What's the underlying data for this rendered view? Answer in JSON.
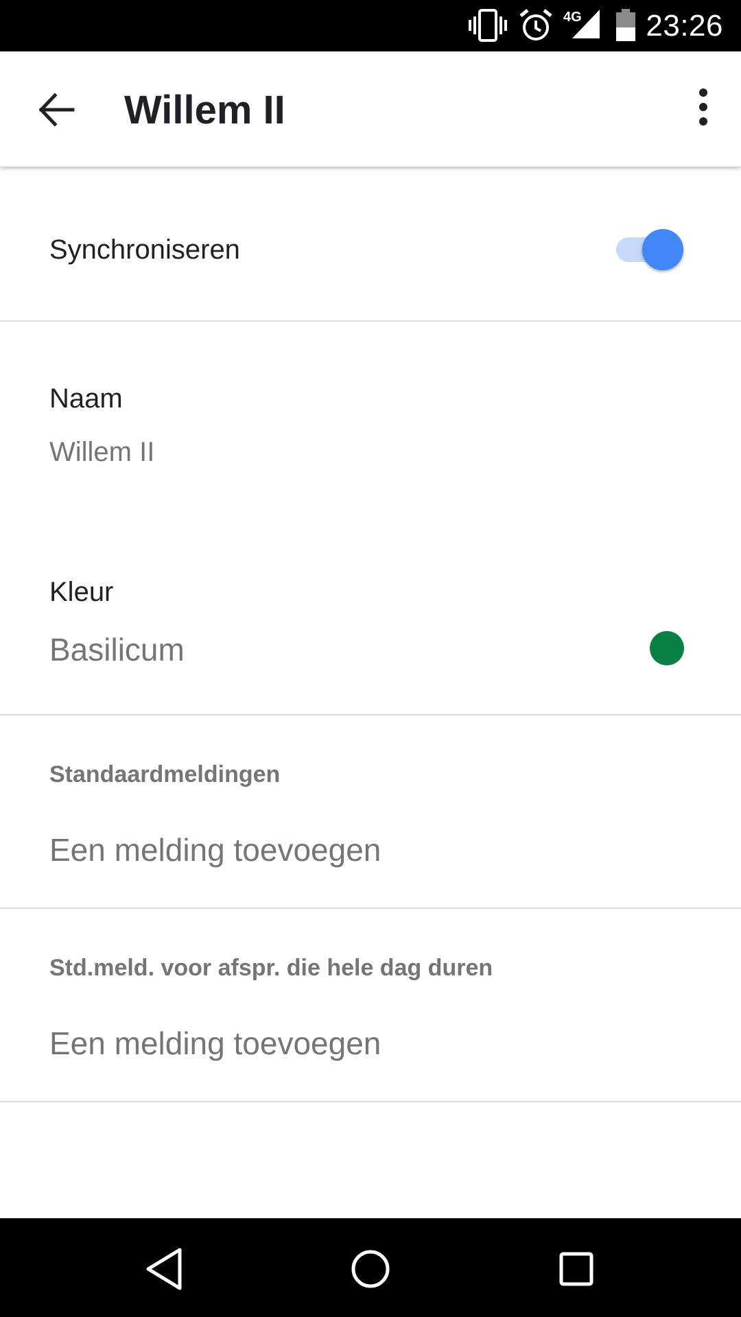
{
  "status_bar": {
    "time": "23:26",
    "network": "4G",
    "icons": [
      "vibrate-icon",
      "alarm-icon",
      "signal-icon",
      "battery-icon"
    ]
  },
  "app_bar": {
    "title": "Willem II",
    "back_icon": "arrow-back-icon",
    "more_icon": "more-vert-icon"
  },
  "sync": {
    "label": "Synchroniseren",
    "enabled": true,
    "accent_color": "#4285f4"
  },
  "name": {
    "label": "Naam",
    "value": "Willem II"
  },
  "color": {
    "label": "Kleur",
    "value": "Basilicum",
    "swatch": "#0b8043"
  },
  "default_notifications": {
    "heading": "Standaardmeldingen",
    "add_label": "Een melding toevoegen"
  },
  "all_day_notifications": {
    "heading": "Std.meld. voor afspr. die hele dag duren",
    "add_label": "Een melding toevoegen"
  },
  "nav_bar": {
    "icons": [
      "back-triangle-icon",
      "home-circle-icon",
      "recents-square-icon"
    ]
  }
}
